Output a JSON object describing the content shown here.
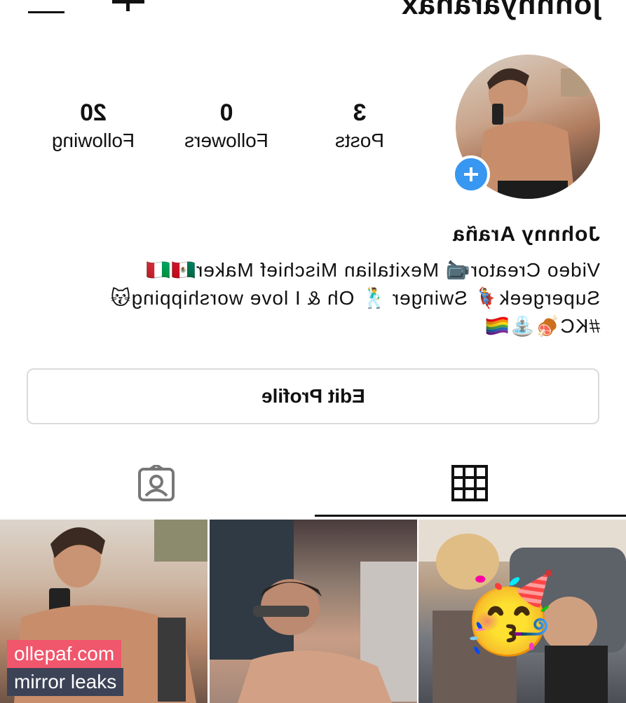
{
  "header": {
    "username": "johnnyarañax",
    "menu_icon": "hamburger-menu-icon",
    "new_post_icon": "plus-icon"
  },
  "profile": {
    "avatar_icon": "add-story-plus-icon",
    "stats": {
      "posts_count": "3",
      "posts_label": "Posts",
      "followers_count": "0",
      "followers_label": "Followers",
      "following_count": "20",
      "following_label": "Following"
    },
    "display_name": "Johnny Araña",
    "bio_lines": [
      "Video Creator📹 Mexitalian Mischief Maker🇲🇽🇮🇹",
      "Supergeek🦸‍♂️ Swinger 🕺 Oh & I love worshipping😽",
      "#KC🍖⛲🏳️‍🌈"
    ],
    "edit_button_label": "Edit Profile"
  },
  "tabs": {
    "grid_icon": "grid-icon",
    "tagged_icon": "tagged-person-icon",
    "active": "grid"
  },
  "posts": {
    "count": 3,
    "sticker_emoji": "🥳"
  },
  "watermark": {
    "line1": "ollepaf.com",
    "line2": "mirror leaks",
    "line1_color": "#f0566c",
    "line2_color": "#3d4356"
  },
  "colors": {
    "accent_blue": "#3897f0",
    "border_gray": "#dbdbdb",
    "text": "#111111"
  }
}
